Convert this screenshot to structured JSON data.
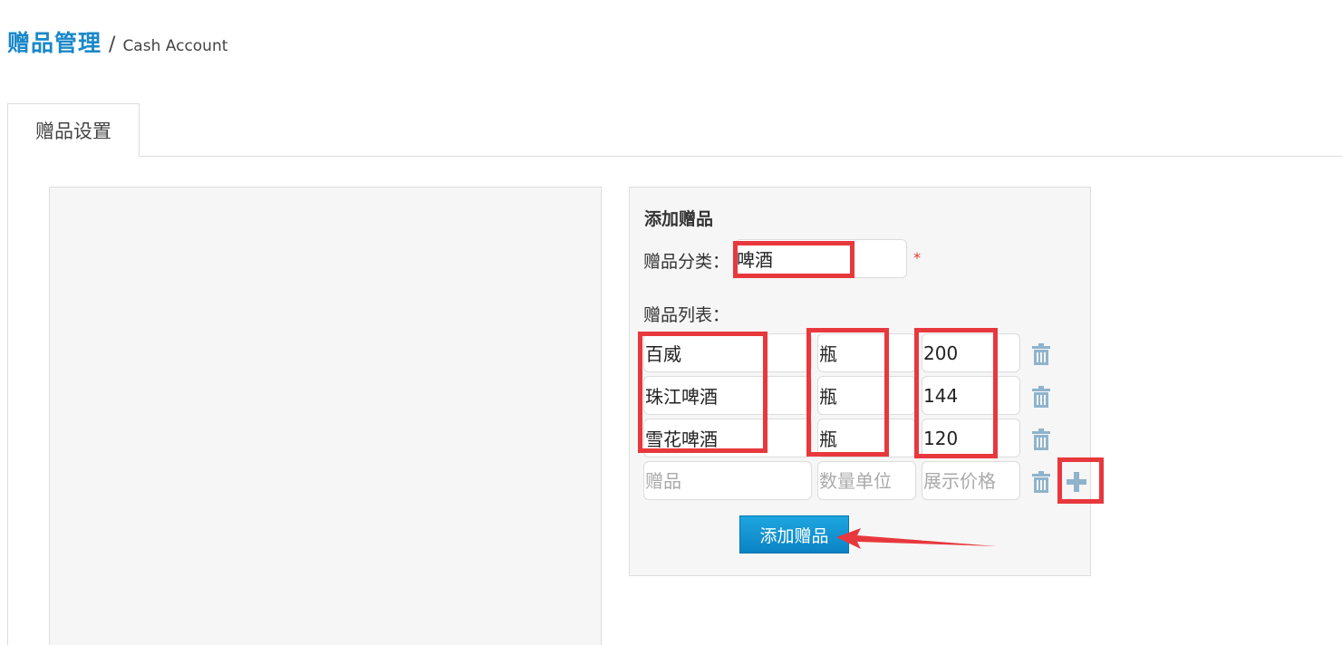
{
  "header": {
    "title": "赠品管理",
    "separator": "/",
    "subtitle": "Cash Account"
  },
  "tabs": [
    {
      "label": "赠品设置",
      "active": true
    }
  ],
  "form": {
    "title": "添加赠品",
    "category_label": "赠品分类：",
    "category_value": "啤酒",
    "required_mark": "*",
    "list_label": "赠品列表：",
    "items": [
      {
        "name": "百威",
        "unit": "瓶",
        "price": "200"
      },
      {
        "name": "珠江啤酒",
        "unit": "瓶",
        "price": "144"
      },
      {
        "name": "雪花啤酒",
        "unit": "瓶",
        "price": "120"
      }
    ],
    "new_item_placeholders": {
      "name": "赠品",
      "unit": "数量单位",
      "price": "展示价格"
    },
    "submit_label": "添加赠品"
  },
  "icons": {
    "delete": "trash-icon",
    "add": "plus-icon"
  },
  "colors": {
    "brand": "#1a88c9",
    "button": "#0c82c4",
    "annotation": "#e8383d",
    "required": "#e53935",
    "icon": "#8fb3cc"
  }
}
